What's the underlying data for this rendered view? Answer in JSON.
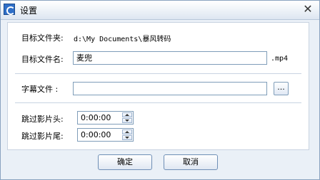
{
  "window": {
    "title": "设置",
    "close_glyph": "✕"
  },
  "target_folder": {
    "label": "目标文件夹:",
    "value": "d:\\My Documents\\暴风转码"
  },
  "target_filename": {
    "label": "目标文件名:",
    "value": "麦兜",
    "extension": ".mp4"
  },
  "subtitle_file": {
    "label": "字幕文件  :",
    "value": "",
    "browse_label": "..."
  },
  "skip_start": {
    "label": "跳过影片头:",
    "value": "0:00:00"
  },
  "skip_end": {
    "label": "跳过影片尾:",
    "value": "0:00:00"
  },
  "buttons": {
    "ok": "确定",
    "cancel": "取消"
  },
  "icons": {
    "app": "app-icon",
    "close": "close-icon",
    "spin_up": "spin-up-arrow-icon",
    "spin_down": "spin-down-arrow-icon"
  }
}
